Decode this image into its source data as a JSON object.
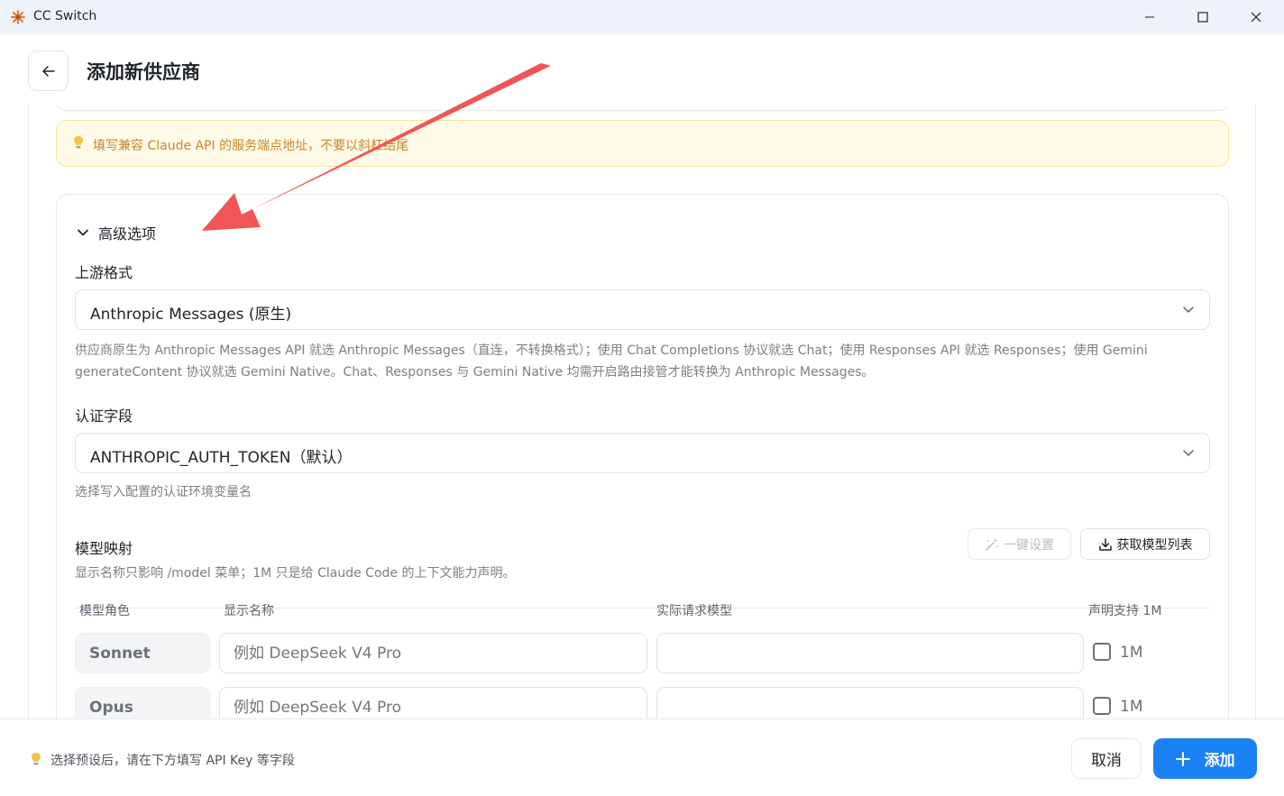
{
  "window": {
    "title": "CC Switch",
    "controls": [
      "minimize-icon",
      "maximize-icon",
      "close-icon"
    ]
  },
  "header": {
    "title": "添加新供应商",
    "back_icon": "arrow-left-icon"
  },
  "hint": {
    "icon": "lightbulb-icon",
    "text": "填写兼容 Claude API 的服务端点地址，不要以斜杠结尾"
  },
  "advanced": {
    "toggle_label": "高级选项",
    "upstream": {
      "label": "上游格式",
      "value": "Anthropic Messages (原生)",
      "help": "供应商原生为 Anthropic Messages API 就选 Anthropic Messages（直连，不转换格式）；使用 Chat Completions 协议就选 Chat；使用 Responses API 就选 Responses；使用 Gemini generateContent 协议就选 Gemini Native。Chat、Responses 与 Gemini Native 均需开启路由接管才能转换为 Anthropic Messages。"
    },
    "auth": {
      "label": "认证字段",
      "value": "ANTHROPIC_AUTH_TOKEN（默认）",
      "help": "选择写入配置的认证环境变量名"
    },
    "model_mapping": {
      "title": "模型映射",
      "one_click_label": "一键设置",
      "fetch_label": "获取模型列表",
      "help": "显示名称只影响 /model 菜单；1M 只是给 Claude Code 的上下文能力声明。",
      "columns": [
        "模型角色",
        "显示名称",
        "实际请求模型",
        "声明支持 1M"
      ],
      "rows": [
        {
          "role": "Sonnet",
          "display_placeholder": "例如 DeepSeek V4 Pro",
          "model_value": "",
          "checkbox_label": "1M",
          "checked": false
        },
        {
          "role": "Opus",
          "display_placeholder": "例如 DeepSeek V4 Pro",
          "model_value": "",
          "checkbox_label": "1M",
          "checked": false
        }
      ]
    }
  },
  "footer": {
    "icon": "lightbulb-icon",
    "text": "选择预设后，请在下方填写 API Key 等字段",
    "cancel_label": "取消",
    "add_label": "添加"
  },
  "colors": {
    "accent": "#1a82f5",
    "hint_bg": "#fefbe8",
    "hint_text": "#c9862a",
    "annotation_arrow": "#f25555"
  }
}
